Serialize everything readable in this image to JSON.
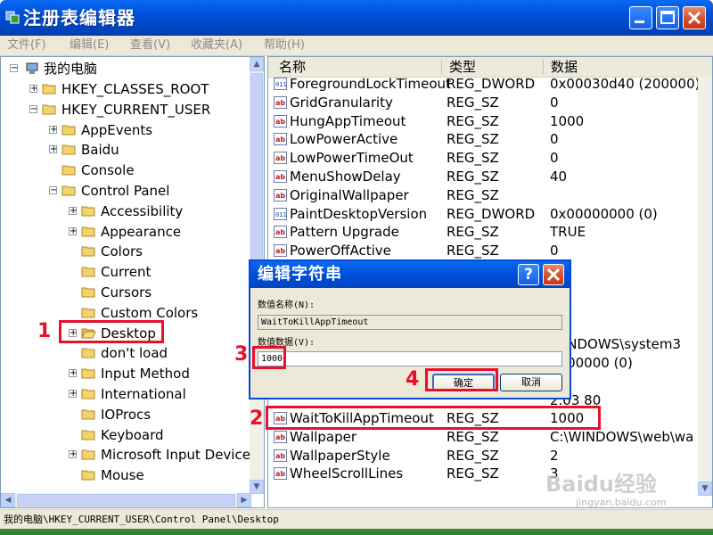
{
  "window": {
    "title": "注册表编辑器"
  },
  "menu": [
    "文件(F)",
    "编辑(E)",
    "查看(V)",
    "收藏夹(A)",
    "帮助(H)"
  ],
  "tree": {
    "root": "我的电脑",
    "items": [
      {
        "label": "HKEY_CLASSES_ROOT"
      },
      {
        "label": "HKEY_CURRENT_USER"
      },
      {
        "label": "AppEvents"
      },
      {
        "label": "Baidu"
      },
      {
        "label": "Console"
      },
      {
        "label": "Control Panel"
      },
      {
        "label": "Accessibility"
      },
      {
        "label": "Appearance"
      },
      {
        "label": "Colors"
      },
      {
        "label": "Current"
      },
      {
        "label": "Cursors"
      },
      {
        "label": "Custom Colors"
      },
      {
        "label": "Desktop"
      },
      {
        "label": "don't load"
      },
      {
        "label": "Input Method"
      },
      {
        "label": "International"
      },
      {
        "label": "IOProcs"
      },
      {
        "label": "Keyboard"
      },
      {
        "label": "Microsoft Input Devices"
      },
      {
        "label": "Mouse"
      }
    ]
  },
  "list": {
    "headers": {
      "name": "名称",
      "type": "类型",
      "data": "数据"
    },
    "rows": [
      {
        "name": "ForegroundLockTimeout",
        "type": "REG_DWORD",
        "data": "0x00030d40 (200000)"
      },
      {
        "name": "GridGranularity",
        "type": "REG_SZ",
        "data": "0"
      },
      {
        "name": "HungAppTimeout",
        "type": "REG_SZ",
        "data": "1000"
      },
      {
        "name": "LowPowerActive",
        "type": "REG_SZ",
        "data": "0"
      },
      {
        "name": "LowPowerTimeOut",
        "type": "REG_SZ",
        "data": "0"
      },
      {
        "name": "MenuShowDelay",
        "type": "REG_SZ",
        "data": "40"
      },
      {
        "name": "OriginalWallpaper",
        "type": "REG_SZ",
        "data": ""
      },
      {
        "name": "PaintDesktopVersion",
        "type": "REG_DWORD",
        "data": "0x00000000 (0)"
      },
      {
        "name": "Pattern Upgrade",
        "type": "REG_SZ",
        "data": "TRUE"
      },
      {
        "name": "PowerOffActive",
        "type": "REG_SZ",
        "data": "0"
      }
    ],
    "partial_data": [
      "WINDOWS\\system3",
      "0000000 (0)",
      "2.03 80"
    ],
    "rows_after": [
      {
        "name": "WaitToKillAppTimeout",
        "type": "REG_SZ",
        "data": "1000"
      },
      {
        "name": "Wallpaper",
        "type": "REG_SZ",
        "data": "C:\\WINDOWS\\web\\wa"
      },
      {
        "name": "WallpaperStyle",
        "type": "REG_SZ",
        "data": "2"
      },
      {
        "name": "WheelScrollLines",
        "type": "REG_SZ",
        "data": "3"
      }
    ]
  },
  "dialog": {
    "title": "编辑字符串",
    "name_label": "数值名称(N):",
    "name_value": "WaitToKillAppTimeout",
    "data_label": "数值数据(V):",
    "data_value": "1000",
    "ok_label": "确定",
    "cancel_label": "取消"
  },
  "status": "我的电脑\\HKEY_CURRENT_USER\\Control Panel\\Desktop",
  "annotations": [
    "1",
    "2",
    "3",
    "4"
  ],
  "watermark": {
    "brand": "Baidu经验",
    "url": "jingyan.baidu.com"
  },
  "colors": {
    "titlebar": "#0050d8",
    "annotation": "#e8102a",
    "chrome": "#ece9d8"
  }
}
